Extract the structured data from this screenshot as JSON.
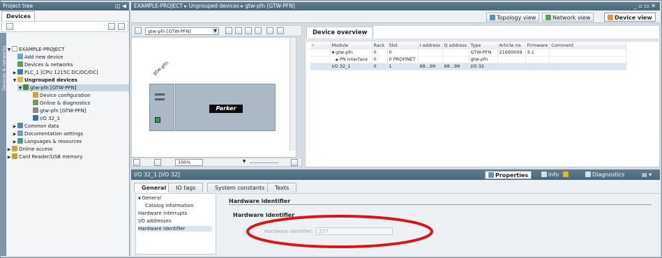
{
  "project_tree": {
    "title": "Project tree",
    "devices_tab": "Devices",
    "side_label": "Devices & networks",
    "items": [
      {
        "label": "EXAMPLE-PROJECT"
      },
      {
        "label": "Add new device"
      },
      {
        "label": "Devices & networks"
      },
      {
        "label": "PLC_1 [CPU 1215C DC/DC/DC]"
      },
      {
        "label": "Ungrouped devices"
      },
      {
        "label": "gtw-pfn [GTW-PFN]"
      },
      {
        "label": "Device configuration"
      },
      {
        "label": "Online & diagnostics"
      },
      {
        "label": "gtw-pfn [GTW-PFN]"
      },
      {
        "label": "I/O 32_1"
      },
      {
        "label": "Common data"
      },
      {
        "label": "Documentation settings"
      },
      {
        "label": "Languages & resources"
      },
      {
        "label": "Online access"
      },
      {
        "label": "Card Reader/USB memory"
      }
    ]
  },
  "breadcrumb": "EXAMPLE-PROJECT ▸ Ungrouped devices ▸ gtw-pfn [GTW-PFN]",
  "views": {
    "topology": "Topology view",
    "network": "Network view",
    "device": "Device view"
  },
  "device_toolbar": {
    "device_select": "gtw-pfn [GTW-PFN]"
  },
  "canvas": {
    "device_label": "gtw-pfn",
    "brand": "Parker",
    "zoom": "100%"
  },
  "device_overview": {
    "tab": "Device overview",
    "columns": [
      "Module",
      "Rack",
      "Slot",
      "I address",
      "Q address",
      "Type",
      "Article no.",
      "Firmware",
      "Comment"
    ],
    "rows": [
      {
        "module": "gtw-pfn",
        "rack": "0",
        "slot": "0",
        "i": "",
        "q": "",
        "type": "GTW-PFN",
        "article": "21690009",
        "fw": "3.1",
        "comment": ""
      },
      {
        "module": "PN Interface",
        "rack": "0",
        "slot": "0 PROFINET",
        "i": "",
        "q": "",
        "type": "gtw-pfn",
        "article": "",
        "fw": "",
        "comment": ""
      },
      {
        "module": "I/O 32_1",
        "rack": "0",
        "slot": "1",
        "i": "68...99",
        "q": "68...99",
        "type": "I/O 32",
        "article": "",
        "fw": "",
        "comment": ""
      }
    ]
  },
  "properties_panel": {
    "title": "I/O 32_1 [I/O 32]",
    "properties": "Properties",
    "info": "Info",
    "diagnostics": "Diagnostics",
    "tabs": [
      "General",
      "IO tags",
      "System constants",
      "Texts"
    ],
    "nav": [
      {
        "label": "General"
      },
      {
        "label": "Catalog information"
      },
      {
        "label": "Hardware interrupts"
      },
      {
        "label": "I/O addresses"
      },
      {
        "label": "Hardware identifier"
      }
    ],
    "section_title": "Hardware identifier",
    "sub_title": "Hardware identifier",
    "field_label": "Hardware identifier:",
    "field_value": "277"
  }
}
